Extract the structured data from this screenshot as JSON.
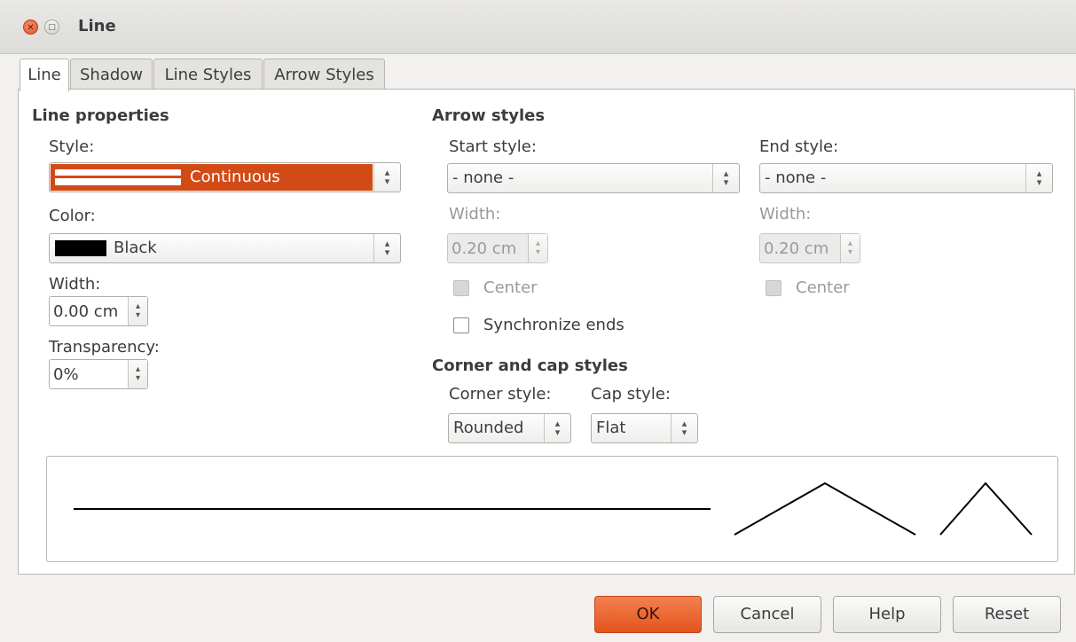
{
  "window": {
    "title": "Line"
  },
  "tabs": [
    {
      "label": "Line"
    },
    {
      "label": "Shadow"
    },
    {
      "label": "Line Styles"
    },
    {
      "label": "Arrow Styles"
    }
  ],
  "line_properties": {
    "heading": "Line properties",
    "style_label": "Style:",
    "style_value": "Continuous",
    "color_label": "Color:",
    "color_value": "Black",
    "color_swatch": "#000000",
    "width_label": "Width:",
    "width_value": "0.00 cm",
    "transparency_label": "Transparency:",
    "transparency_value": "0%"
  },
  "arrow_styles": {
    "heading": "Arrow styles",
    "start_style_label": "Start style:",
    "start_style_value": "- none -",
    "end_style_label": "End style:",
    "end_style_value": "- none -",
    "start_width_label": "Width:",
    "start_width_value": "0.20 cm",
    "end_width_label": "Width:",
    "end_width_value": "0.20 cm",
    "start_center_label": "Center",
    "end_center_label": "Center",
    "synchronize_label": "Synchronize ends"
  },
  "corner_cap": {
    "heading": "Corner and cap styles",
    "corner_label": "Corner style:",
    "corner_value": "Rounded",
    "cap_label": "Cap style:",
    "cap_value": "Flat"
  },
  "buttons": {
    "ok": "OK",
    "cancel": "Cancel",
    "help": "Help",
    "reset": "Reset"
  },
  "colors": {
    "accent": "#e2541d",
    "selection": "#d24b16"
  }
}
